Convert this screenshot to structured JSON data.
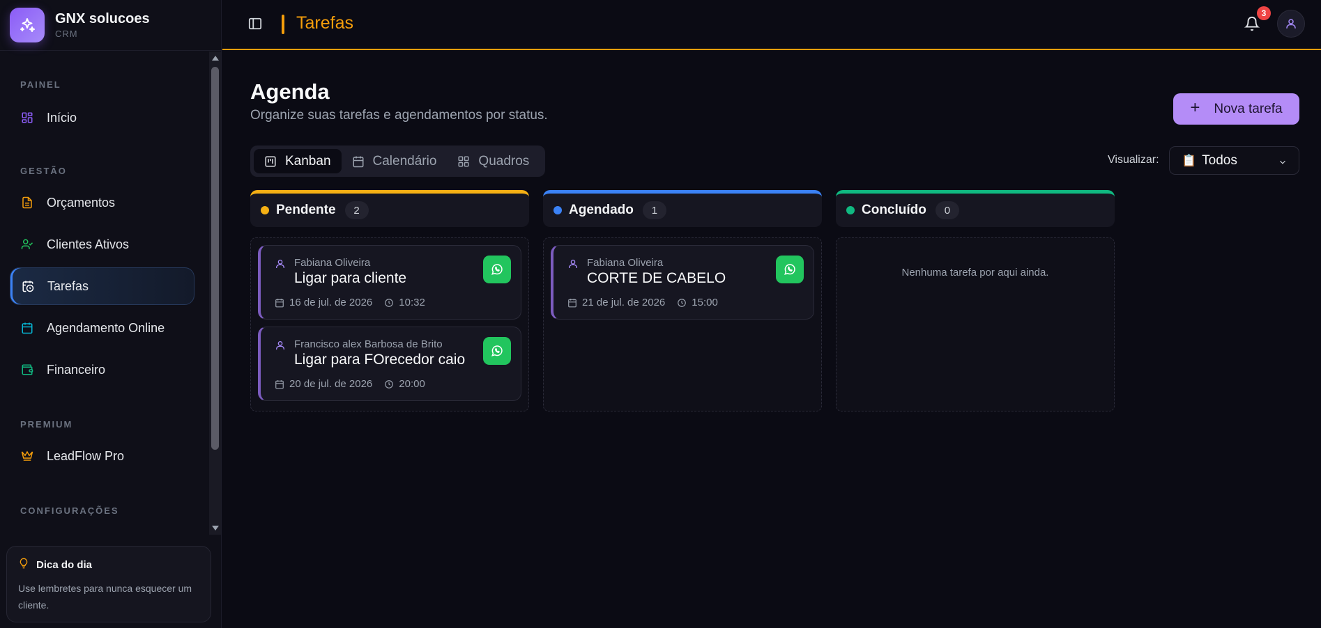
{
  "brand": {
    "name": "GNX solucoes",
    "sub": "CRM"
  },
  "sidebar": {
    "sections": {
      "painel": "PAINEL",
      "gestao": "GESTÃO",
      "premium": "PREMIUM",
      "config": "CONFIGURAÇÕES"
    },
    "items": {
      "inicio": "Início",
      "orcamentos": "Orçamentos",
      "clientes": "Clientes Ativos",
      "tarefas": "Tarefas",
      "agendamento": "Agendamento Online",
      "financeiro": "Financeiro",
      "leadflow": "LeadFlow Pro"
    },
    "tip": {
      "title": "Dica do dia",
      "text": "Use lembretes para nunca esquecer um cliente."
    }
  },
  "header": {
    "title": "Tarefas",
    "notifications": "3"
  },
  "main": {
    "title": "Agenda",
    "subtitle": "Organize suas tarefas e agendamentos por status.",
    "new_button": "Nova tarefa",
    "tabs": {
      "kanban": "Kanban",
      "calendario": "Calendário",
      "quadros": "Quadros"
    },
    "view_label": "Visualizar:",
    "view_emoji": "📋",
    "view_value": "Todos"
  },
  "columns": {
    "pendente": {
      "label": "Pendente",
      "count": "2"
    },
    "agendado": {
      "label": "Agendado",
      "count": "1"
    },
    "concluido": {
      "label": "Concluído",
      "count": "0",
      "empty": "Nenhuma tarefa por aqui ainda."
    }
  },
  "cards": [
    {
      "client": "Fabiana Oliveira",
      "title": "Ligar para cliente",
      "date": "16 de jul. de 2026",
      "time": "10:32"
    },
    {
      "client": "Francisco alex Barbosa de Brito",
      "title": "Ligar para FOrecedor caio",
      "date": "20 de jul. de 2026",
      "time": "20:00"
    },
    {
      "client": "Fabiana Oliveira",
      "title": "CORTE DE CABELO",
      "date": "21 de jul. de 2026",
      "time": "15:00"
    }
  ],
  "colors": {
    "accent": "#f59e0b",
    "primary": "#b48cf7",
    "pending": "#f5b014",
    "scheduled": "#3b82f6",
    "done": "#10b981",
    "whatsapp": "#22c55e"
  }
}
